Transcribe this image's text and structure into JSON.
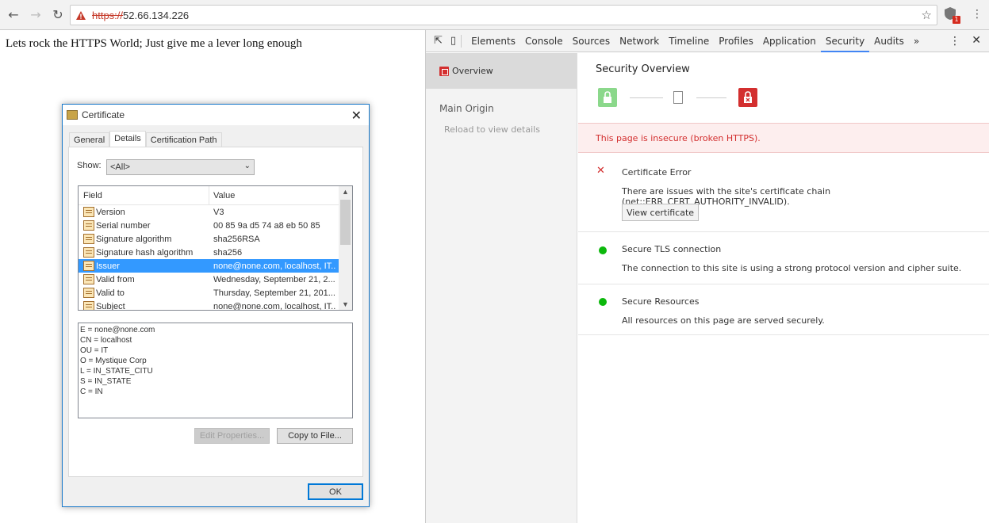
{
  "browser": {
    "url_scheme": "https://",
    "url_host": "52.66.134.226",
    "extension_badge": "1",
    "icons": [
      "back-icon",
      "forward-icon",
      "reload-icon",
      "warning-icon",
      "star-icon",
      "menu-icon"
    ]
  },
  "page": {
    "text": "Lets rock the HTTPS World; Just give me a lever long enough"
  },
  "certificate": {
    "title": "Certificate",
    "tabs": [
      "General",
      "Details",
      "Certification Path"
    ],
    "active_tab": "Details",
    "show_label": "Show:",
    "show_value": "<All>",
    "columns": [
      "Field",
      "Value"
    ],
    "rows": [
      {
        "field": "Version",
        "value": "V3"
      },
      {
        "field": "Serial number",
        "value": "00 85 9a d5 74 a8 eb 50 85"
      },
      {
        "field": "Signature algorithm",
        "value": "sha256RSA"
      },
      {
        "field": "Signature hash algorithm",
        "value": "sha256"
      },
      {
        "field": "Issuer",
        "value": "none@none.com, localhost, IT..."
      },
      {
        "field": "Valid from",
        "value": "Wednesday, September 21, 2..."
      },
      {
        "field": "Valid to",
        "value": "Thursday, September 21, 201..."
      },
      {
        "field": "Subject",
        "value": "none@none.com, localhost, IT..."
      }
    ],
    "selected_row": "Issuer",
    "detail_lines": [
      "E = none@none.com",
      "CN = localhost",
      "OU = IT",
      "O = Mystique Corp",
      "L = IN_STATE_CITU",
      "S = IN_STATE",
      "C = IN"
    ],
    "edit_properties": "Edit Properties...",
    "copy_to_file": "Copy to File...",
    "ok": "OK"
  },
  "devtools": {
    "tabs": [
      "Elements",
      "Console",
      "Sources",
      "Network",
      "Timeline",
      "Profiles",
      "Application",
      "Security",
      "Audits"
    ],
    "active_tab": "Security",
    "more": "»",
    "sidebar": {
      "overview": "Overview",
      "main_origin": "Main Origin",
      "reload": "Reload to view details"
    },
    "security": {
      "title": "Security Overview",
      "banner": "This page is insecure (broken HTTPS).",
      "items": [
        {
          "heading": "Certificate Error",
          "description": "There are issues with the site's certificate chain (net::ERR_CERT_AUTHORITY_INVALID).",
          "button": "View certificate",
          "status": "error"
        },
        {
          "heading": "Secure TLS connection",
          "description": "The connection to this site is using a strong protocol version and cipher suite.",
          "status": "secure"
        },
        {
          "heading": "Secure Resources",
          "description": "All resources on this page are served securely.",
          "status": "secure"
        }
      ]
    }
  },
  "colors": {
    "error": "#d32f2f",
    "secure": "#0cb80c",
    "accent": "#4285f4",
    "selection": "#3399ff"
  }
}
